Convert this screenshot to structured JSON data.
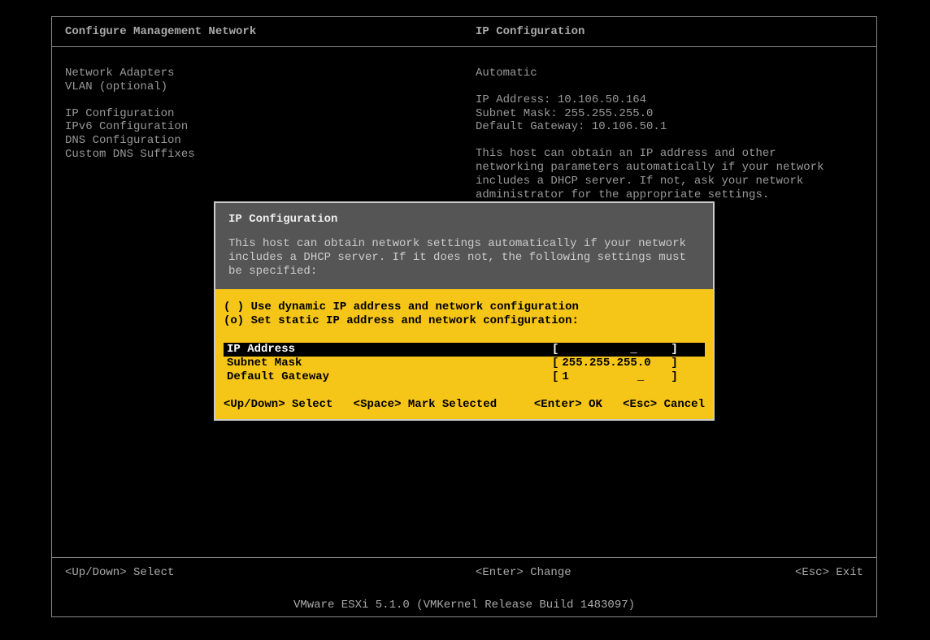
{
  "header": {
    "left": "Configure Management Network",
    "right": "IP Configuration"
  },
  "leftMenu": {
    "items": [
      "Network Adapters",
      "VLAN (optional)",
      "",
      "IP Configuration",
      "IPv6 Configuration",
      "DNS Configuration",
      "Custom DNS Suffixes"
    ]
  },
  "rightPanel": {
    "mode": "Automatic",
    "kv": [
      "IP Address: 10.106.50.164",
      "Subnet Mask: 255.255.255.0",
      "Default Gateway: 10.106.50.1"
    ],
    "desc": "This host can obtain an IP address and other networking parameters automatically if your network includes a DHCP server. If not, ask your network administrator for the appropriate settings."
  },
  "dialog": {
    "title": "IP Configuration",
    "intro": "This host can obtain network settings automatically if your network includes a DHCP server. If it does not, the following settings must be specified:",
    "options": [
      {
        "mark": "( )",
        "text": "Use dynamic IP address and network configuration"
      },
      {
        "mark": "(o)",
        "text": "Set static IP address and network configuration:"
      }
    ],
    "fields": [
      {
        "label": "IP Address",
        "value": "          _",
        "selected": true
      },
      {
        "label": "Subnet Mask",
        "value": "255.255.255.0",
        "selected": false
      },
      {
        "label": "Default Gateway",
        "value": "1          _",
        "selected": false
      }
    ],
    "footLeft": [
      {
        "key": "<Up/Down>",
        "act": "Select"
      },
      {
        "key": "<Space>",
        "act": "Mark Selected"
      }
    ],
    "footRight": [
      {
        "key": "<Enter>",
        "act": "OK"
      },
      {
        "key": "<Esc>",
        "act": "Cancel"
      }
    ]
  },
  "bottom": {
    "left": {
      "key": "<Up/Down>",
      "act": "Select"
    },
    "mid": {
      "key": "<Enter>",
      "act": "Change"
    },
    "right": {
      "key": "<Esc>",
      "act": "Exit"
    }
  },
  "version": "VMware ESXi 5.1.0 (VMKernel Release Build 1483097)"
}
